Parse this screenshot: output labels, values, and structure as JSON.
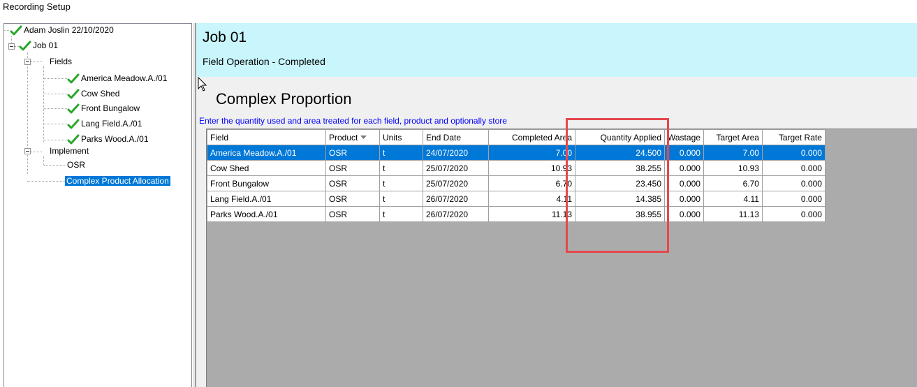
{
  "window_title": "Recording Setup",
  "tree": {
    "root": {
      "label": "Adam Joslin 22/10/2020"
    },
    "job": {
      "label": "Job 01"
    },
    "fields_folder": {
      "label": "Fields"
    },
    "fields": [
      {
        "label": "America Meadow.A./01"
      },
      {
        "label": "Cow Shed"
      },
      {
        "label": "Front Bungalow"
      },
      {
        "label": "Lang Field.A./01"
      },
      {
        "label": "Parks Wood.A./01"
      }
    ],
    "implement_folder": {
      "label": "Implement"
    },
    "implement_item": {
      "label": "OSR"
    },
    "complex_item": {
      "label": "Complex Product Allocation"
    }
  },
  "header": {
    "title": "Job 01",
    "subtitle": "Field Operation - Completed"
  },
  "section": {
    "title": "Complex Proportion",
    "instruction": "Enter the quantity used and area treated for each field, product and optionally store"
  },
  "grid": {
    "columns": [
      "Field",
      "Product",
      "Units",
      "End Date",
      "Completed Area",
      "Quantity Applied",
      "Wastage",
      "Target Area",
      "Target Rate"
    ],
    "rows": [
      [
        "America Meadow.A./01",
        "OSR",
        "t",
        "24/07/2020",
        "7.00",
        "24.500",
        "0.000",
        "7.00",
        "0.000"
      ],
      [
        "Cow Shed",
        "OSR",
        "t",
        "25/07/2020",
        "10.93",
        "38.255",
        "0.000",
        "10.93",
        "0.000"
      ],
      [
        "Front Bungalow",
        "OSR",
        "t",
        "25/07/2020",
        "6.70",
        "23.450",
        "0.000",
        "6.70",
        "0.000"
      ],
      [
        "Lang Field.A./01",
        "OSR",
        "t",
        "26/07/2020",
        "4.11",
        "14.385",
        "0.000",
        "4.11",
        "0.000"
      ],
      [
        "Parks Wood.A./01",
        "OSR",
        "t",
        "26/07/2020",
        "11.13",
        "38.955",
        "0.000",
        "11.13",
        "0.000"
      ]
    ]
  },
  "colors": {
    "header_band": "#c9f6fd",
    "selection": "#0078d7",
    "instruction_text": "#0000ff",
    "highlight_box": "#e5484d",
    "check": "#2aa52a"
  },
  "icons": {
    "tree_check": "check-icon",
    "sort": "sort-desc-icon"
  }
}
